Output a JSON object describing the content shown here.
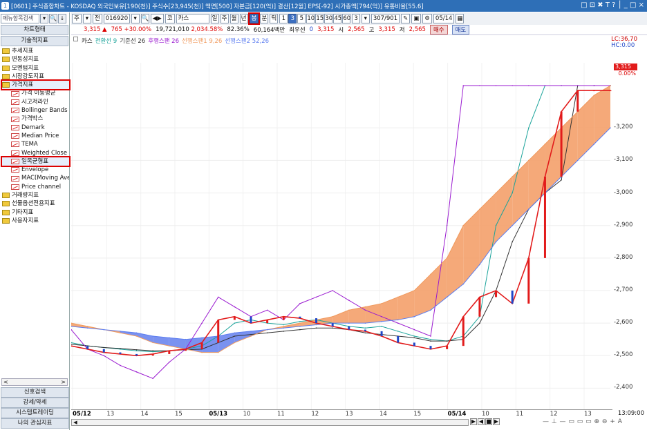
{
  "titlebar": {
    "app_icon": "1",
    "text": "[0601] 주식종합차트 - KOSDAQ 외국인보유[190(천)] 주식수[23,945(천)] 액면[500] 자본금[120(억)] 결산[12월] EPS[-92] 시가총액[794(억)] 유통비율[55.6]",
    "window_buttons": "□ ⊡ ✖ T ? │ _ □ ×"
  },
  "sidebar": {
    "search_placeholder": "메뉴항목검색",
    "search_btn_dropdown": "▾",
    "search_btn_find": "🔍",
    "search_btn_down": "↓",
    "tab_chart": "차트형태",
    "tab_tech": "기술적지표",
    "categories": [
      {
        "label": "추세지표"
      },
      {
        "label": "변동성지표"
      },
      {
        "label": "모멘텀지표"
      },
      {
        "label": "시장강도지표"
      },
      {
        "label": "가격지표",
        "selected": true
      }
    ],
    "price_children": [
      "가격 이동평균",
      "시고저라인",
      "Bollinger Bands",
      "가격박스",
      "Demark",
      "Median Price",
      "TEMA",
      "Weighted Close",
      "일목균형표",
      "Envelope",
      "MAC(Moving Ave",
      "Price channel"
    ],
    "selected_child": 8,
    "categories2": [
      "거래량지표",
      "선물옵션전용지표",
      "기타지표",
      "사용자지표"
    ],
    "scroll_left": "<",
    "scroll_right": ">",
    "bottom_buttons": [
      "신호검색",
      "강세/약세",
      "시스템트레이딩",
      "나의 관심지표"
    ]
  },
  "toolbar1": {
    "main_btn": "주",
    "main_dd": "▾",
    "full_btn": "전",
    "code": "016920",
    "code_dd": "▾",
    "search": "🔍",
    "prev_next": "◀▶",
    "market_tag": "코",
    "stock_name": "카스",
    "period_day": "일",
    "period_week": "주",
    "period_month": "월",
    "period_year": "년",
    "period_split": "분",
    "highlight_btn": "봉",
    "tick_btn": "틱",
    "intervals": [
      "1",
      "3",
      "5",
      "10",
      "15",
      "30",
      "45",
      "60"
    ],
    "count": "3",
    "count_dd": "▾",
    "range": "307/901",
    "date": "05/14",
    "date_icon": "▦"
  },
  "toolbar2": {
    "price": "3,315",
    "arrow": "▲",
    "change": "765 +30.00%",
    "volume": "19,721,010",
    "volume_pct": "2,034.58%",
    "ratio": "82.36%",
    "amount": "60,164백만",
    "preferred_label": "최우선",
    "preferred_value": "0",
    "price2": "3,315",
    "open_label": "시",
    "open": "2,565",
    "high_label": "고",
    "high": "3,315",
    "low_label": "저",
    "low": "2,565",
    "buy": "매수",
    "sell": "매도"
  },
  "chart": {
    "legend_name": "카스",
    "legend_items": [
      {
        "text": "전환선 9",
        "color": "#1aa39a"
      },
      {
        "text": "기준선 26",
        "color": "#333333"
      },
      {
        "text": "후행스팬 26",
        "color": "#9a1ad0"
      },
      {
        "text": "선행스팬1 9,26",
        "color": "#f09a5e"
      },
      {
        "text": "선행스팬2 52,26",
        "color": "#5c7df0"
      }
    ],
    "lc_label": "LC:36,70",
    "hc_label": "HC:0.00",
    "price_tag": "3,315",
    "price_pct": "0.00%",
    "time": "13:09:00"
  },
  "chart_data": {
    "type": "line",
    "title": "",
    "ylim": [
      2350,
      3400
    ],
    "y_ticks": [
      "3,200",
      "3,100",
      "3,000",
      "2,900",
      "2,800",
      "2,700",
      "2,600",
      "2,500",
      "2,400"
    ],
    "x_ticks": [
      {
        "label": "05/12",
        "bold": true
      },
      {
        "label": "13"
      },
      {
        "label": "14"
      },
      {
        "label": "15"
      },
      {
        "label": "05/13",
        "bold": true
      },
      {
        "label": "10"
      },
      {
        "label": "11"
      },
      {
        "label": "12"
      },
      {
        "label": "13"
      },
      {
        "label": "14"
      },
      {
        "label": "15"
      },
      {
        "label": "05/14",
        "bold": true
      },
      {
        "label": "10"
      },
      {
        "label": "11"
      },
      {
        "label": "12"
      },
      {
        "label": "13"
      }
    ],
    "series": [
      {
        "name": "전환선 9",
        "color": "#1aa39a",
        "values": [
          2540,
          2530,
          2525,
          2520,
          2515,
          2512,
          2515,
          2520,
          2530,
          2560,
          2600,
          2610,
          2600,
          2595,
          2605,
          2610,
          2600,
          2590,
          2585,
          2590,
          2575,
          2560,
          2550,
          2545,
          2560,
          2620,
          2900,
          3000,
          3200,
          3330,
          3330,
          3330,
          3330,
          3330
        ]
      },
      {
        "name": "기준선 26",
        "color": "#333333",
        "values": [
          2535,
          2530,
          2525,
          2522,
          2518,
          2515,
          2515,
          2518,
          2520,
          2540,
          2560,
          2565,
          2570,
          2575,
          2580,
          2585,
          2585,
          2580,
          2570,
          2565,
          2560,
          2555,
          2545,
          2545,
          2550,
          2600,
          2700,
          2850,
          2950,
          3000,
          3040,
          3330,
          3330,
          3330
        ]
      },
      {
        "name": "후행스팬 26",
        "color": "#9a1ad0",
        "values": [
          2580,
          2520,
          2500,
          2470,
          2450,
          2430,
          2480,
          2520,
          2600,
          2680,
          2650,
          2620,
          2640,
          2610,
          2660,
          2680,
          2700,
          2670,
          2640,
          2620,
          2600,
          2580,
          2560,
          2900,
          3330,
          3330,
          3330,
          3330,
          3330,
          3330,
          3330,
          3330,
          3330,
          3330
        ]
      },
      {
        "name": "선행스팬1 9,26",
        "color": "#f09a5e",
        "values": [
          2600,
          2590,
          2580,
          2570,
          2560,
          2540,
          2530,
          2520,
          2510,
          2510,
          2540,
          2560,
          2580,
          2590,
          2600,
          2610,
          2620,
          2640,
          2650,
          2660,
          2680,
          2700,
          2750,
          2800,
          2900,
          2950,
          3000,
          3050,
          3100,
          3150,
          3200,
          3250,
          3300,
          3330
        ]
      },
      {
        "name": "선행스팬2 52,26",
        "color": "#5c7df0",
        "values": [
          2590,
          2585,
          2580,
          2575,
          2570,
          2560,
          2555,
          2550,
          2555,
          2560,
          2570,
          2575,
          2580,
          2585,
          2590,
          2595,
          2600,
          2600,
          2600,
          2605,
          2610,
          2620,
          2640,
          2680,
          2720,
          2780,
          2850,
          2900,
          2950,
          3000,
          3050,
          3100,
          3150,
          3200
        ]
      },
      {
        "name": "카스",
        "color": "#e21b1b",
        "values": [
          2530,
          2520,
          2510,
          2505,
          2500,
          2505,
          2515,
          2520,
          2540,
          2610,
          2620,
          2600,
          2610,
          2620,
          2615,
          2600,
          2590,
          2580,
          2575,
          2560,
          2540,
          2530,
          2520,
          2530,
          2620,
          2680,
          2700,
          2660,
          2800,
          3050,
          3250,
          3315,
          3315,
          3315
        ]
      }
    ]
  }
}
